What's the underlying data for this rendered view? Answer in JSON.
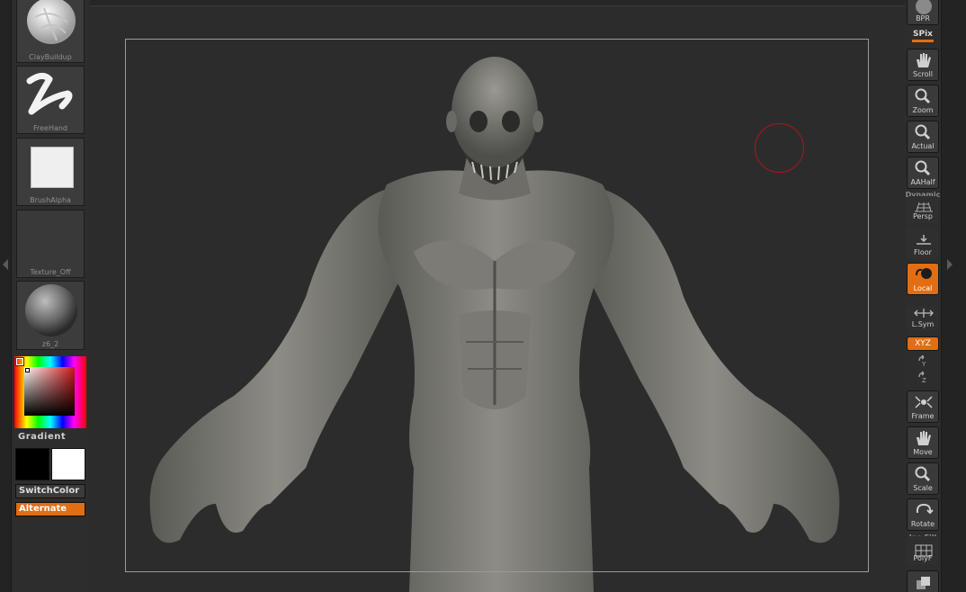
{
  "left_tray": {
    "brush_label": "ClayBuildup",
    "stroke_label": "FreeHand",
    "alpha_label": "BrushAlpha",
    "texture_label": "Texture_Off",
    "material_label": "z6_2"
  },
  "color": {
    "gradient_label": "Gradient",
    "primary_color": "#000000",
    "secondary_color": "#ffffff",
    "switch_label": "SwitchColor",
    "alternate_label": "Alternate"
  },
  "right_shelf": {
    "bpr_label": "BPR",
    "spix_label": "SPix",
    "scroll_label": "Scroll",
    "zoom_label": "Zoom",
    "actual_label": "Actual",
    "aahalf_label": "AAHalf",
    "dynamic_label": "Dynamic",
    "persp_label": "Persp",
    "floor_label": "Floor",
    "local_label": "Local",
    "lsym_label": "L.Sym",
    "xyz_label": "XYZ",
    "frame_label": "Frame",
    "move_label": "Move",
    "scale_label": "Scale",
    "rotate_label": "Rotate",
    "linefill_label": "Ine Fill",
    "polyf_label": "PolyF"
  },
  "colors": {
    "accent": "#e36d12",
    "brush_ring": "#b4121d"
  }
}
